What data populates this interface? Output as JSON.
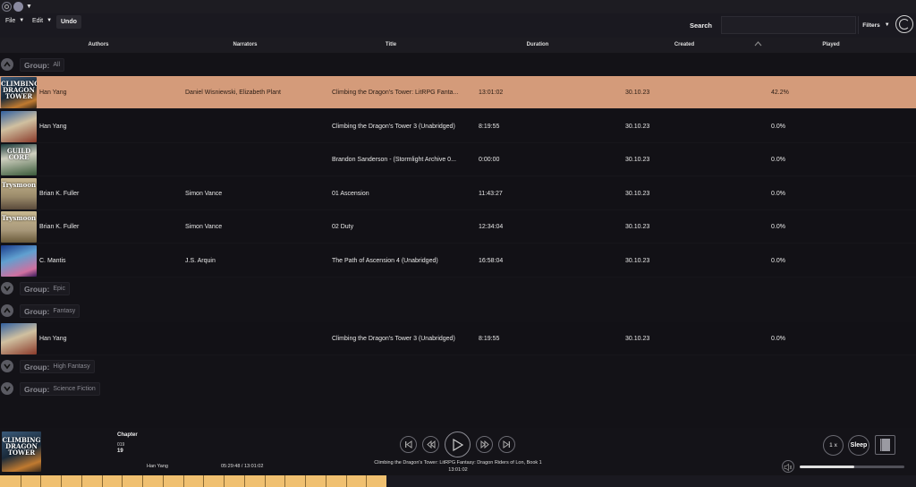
{
  "menu": {
    "file": "File",
    "edit": "Edit",
    "undo": "Undo"
  },
  "search": {
    "label": "Search",
    "placeholder": ""
  },
  "filters": {
    "label": "Filters"
  },
  "columns": {
    "authors": "Authors",
    "narrators": "Narrators",
    "title": "Title",
    "duration": "Duration",
    "created": "Created",
    "played": "Played"
  },
  "group_label": "Group:",
  "groups": [
    {
      "name": "All",
      "expanded": true
    },
    {
      "name": "Epic",
      "expanded": false
    },
    {
      "name": "Fantasy",
      "expanded": true
    },
    {
      "name": "High Fantasy",
      "expanded": false
    },
    {
      "name": "Science Fiction",
      "expanded": false
    }
  ],
  "rows_all": [
    {
      "cover": "climbing-tower-cover",
      "cover_text": "CLIMBING DRAGON TOWER",
      "author": "Han Yang",
      "narrator": "Daniel Wisniewski, Elizabeth Plant",
      "title": "Climbing the Dragon's Tower: LitRPG Fanta...",
      "duration": "13:01:02",
      "created": "30.10.23",
      "played": "42.2%",
      "active": true
    },
    {
      "cover": "climbing-tower-3-cover",
      "cover_text": "",
      "author": "Han Yang",
      "narrator": "",
      "title": "Climbing the Dragon's Tower 3 (Unabridged)",
      "duration": "8:19:55",
      "created": "30.10.23",
      "played": "0.0%",
      "active": false
    },
    {
      "cover": "stormlight-cover",
      "cover_text": "GUILD CORE",
      "author": "",
      "narrator": "",
      "title": "Brandon Sanderson - (Stormlight Archive 0...",
      "duration": "0:00:00",
      "created": "30.10.23",
      "played": "0.0%",
      "active": false
    },
    {
      "cover": "trysmoon-ascension-cover",
      "cover_text": "Trysmoon",
      "author": "Brian K. Fuller",
      "narrator": "Simon Vance",
      "title": "01 Ascension",
      "duration": "11:43:27",
      "created": "30.10.23",
      "played": "0.0%",
      "active": false
    },
    {
      "cover": "trysmoon-duty-cover",
      "cover_text": "Trysmoon",
      "author": "Brian K. Fuller",
      "narrator": "Simon Vance",
      "title": "02 Duty",
      "duration": "12:34:04",
      "created": "30.10.23",
      "played": "0.0%",
      "active": false
    },
    {
      "cover": "path-of-ascension-cover",
      "cover_text": "",
      "author": "C. Mantis",
      "narrator": "J.S. Arquin",
      "title": "The Path of Ascension 4 (Unabridged)",
      "duration": "16:58:04",
      "created": "30.10.23",
      "played": "0.0%",
      "active": false
    }
  ],
  "rows_fantasy": [
    {
      "cover": "climbing-tower-3-cover",
      "cover_text": "",
      "author": "Han Yang",
      "narrator": "",
      "title": "Climbing the Dragon's Tower 3 (Unabridged)",
      "duration": "8:19:55",
      "created": "30.10.23",
      "played": "0.0%",
      "active": false
    }
  ],
  "player": {
    "cover_text": "CLIMBING DRAGON TOWER",
    "chapter_label": "Chapter",
    "chapter_number": "019",
    "chapter_index": "19",
    "author": "Han Yang",
    "time": "05:29:48 / 13:01:02",
    "title": "Climbing the Dragon's Tower: LitRPG Fantasy: Dragon Riders of Lon, Book 1",
    "duration": "13:01:02",
    "speed": "1 x",
    "sleep": "Sleep",
    "volume": 0.52,
    "progress": 0.422
  },
  "colors": {
    "active_row": "#d49b7a",
    "progress": "#f0c070",
    "background": "#131217"
  }
}
